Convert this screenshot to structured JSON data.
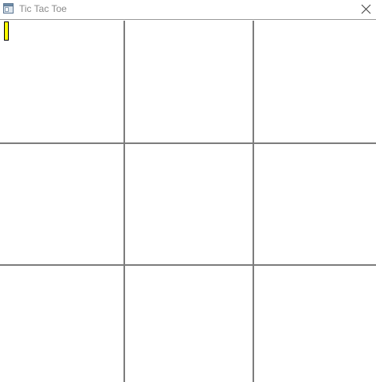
{
  "window": {
    "title": "Tic Tac Toe",
    "icon": "app-window-icon",
    "close_icon": "close-icon"
  },
  "board": {
    "rows": 3,
    "columns": 3,
    "cells": [
      [
        "",
        "",
        ""
      ],
      [
        "",
        "",
        ""
      ],
      [
        "",
        "",
        ""
      ]
    ],
    "focused_cell": [
      0,
      0
    ],
    "line_color": "#7d7d7d",
    "focus_color": "#ffff00"
  }
}
